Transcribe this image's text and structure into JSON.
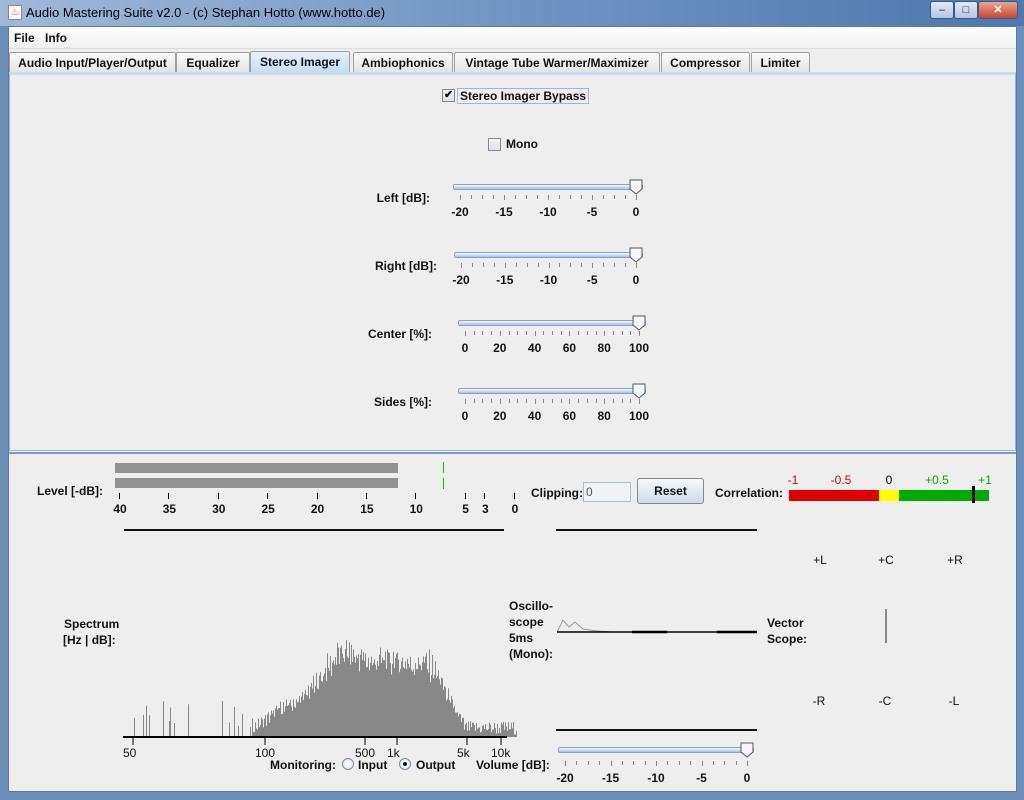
{
  "window": {
    "title": "Audio Mastering Suite v2.0 - (c) Stephan Hotto (www.hotto.de)",
    "minimize": "–",
    "maximize": "□",
    "close": "✕"
  },
  "menu": [
    "File",
    "Info"
  ],
  "tabs": [
    {
      "label": "Audio Input/Player/Output"
    },
    {
      "label": "Equalizer"
    },
    {
      "label": "Stereo Imager",
      "active": true
    },
    {
      "label": "Ambiophonics"
    },
    {
      "label": "Vintage Tube Warmer/Maximizer"
    },
    {
      "label": "Compressor"
    },
    {
      "label": "Limiter"
    }
  ],
  "stereo": {
    "bypass_label": "Stereo Imager Bypass",
    "bypass_checked": true,
    "mono_label": "Mono",
    "mono_checked": false,
    "sliders": [
      {
        "label": "Left [dB]:",
        "ticks": [
          "-20",
          "-15",
          "-10",
          "-5",
          "0"
        ],
        "min": -20,
        "max": 0,
        "value": 0
      },
      {
        "label": "Right [dB]:",
        "ticks": [
          "-20",
          "-15",
          "-10",
          "-5",
          "0"
        ],
        "min": -20,
        "max": 0,
        "value": 0
      },
      {
        "label": "Center [%]:",
        "ticks": [
          "0",
          "20",
          "40",
          "60",
          "80",
          "100"
        ],
        "min": 0,
        "max": 100,
        "value": 100
      },
      {
        "label": "Sides [%]:",
        "ticks": [
          "0",
          "20",
          "40",
          "60",
          "80",
          "100"
        ],
        "min": 0,
        "max": 100,
        "value": 100
      }
    ]
  },
  "meters": {
    "level_label": "Level [-dB]:",
    "level_ticks": [
      "40",
      "35",
      "30",
      "25",
      "20",
      "15",
      "10",
      "5",
      "3",
      "0"
    ],
    "level_left_db": 11,
    "level_right_db": 11,
    "clipping_label": "Clipping:",
    "clipping_value": "0",
    "reset_label": "Reset",
    "correlation_label": "Correlation:",
    "correlation_ticks": [
      "-1",
      "-0.5",
      "0",
      "+0.5",
      "+1"
    ],
    "correlation_value": 0.83,
    "colors": {
      "red": "#dd0000",
      "yellow": "#ffff00",
      "green": "#00aa00"
    }
  },
  "spectrum": {
    "label1": "Spectrum",
    "label2": "[Hz | dB]:",
    "ticks": [
      "50",
      "100",
      "500",
      "1k",
      "5k",
      "10k"
    ]
  },
  "oscilloscope": {
    "label": [
      "Oscillo-",
      "scope",
      "5ms",
      "(Mono):"
    ]
  },
  "vectorscope": {
    "label": [
      "Vector",
      "Scope:"
    ],
    "top": [
      "+L",
      "+C",
      "+R"
    ],
    "bottom": [
      "-R",
      "-C",
      "-L"
    ]
  },
  "monitoring": {
    "label": "Monitoring:",
    "input": "Input",
    "output": "Output",
    "selected": "Output"
  },
  "volume": {
    "label": "Volume [dB]:",
    "ticks": [
      "-20",
      "-15",
      "-10",
      "-5",
      "0"
    ],
    "min": -20,
    "max": 0,
    "value": 0
  }
}
